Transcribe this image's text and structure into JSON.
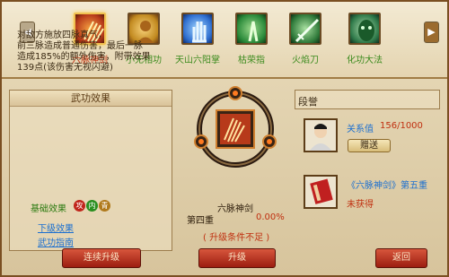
{
  "skills": [
    {
      "label": "六脉神剑",
      "selected": true,
      "icon": "sword-claw-icon",
      "color": "#b73a1a"
    },
    {
      "label": "小无相功",
      "selected": false,
      "icon": "buddha-icon",
      "color": "#c28a20"
    },
    {
      "label": "天山六阳掌",
      "selected": false,
      "icon": "palm-icon",
      "color": "#2f6fd0"
    },
    {
      "label": "枯荣指",
      "selected": false,
      "icon": "finger-icon",
      "color": "#2a8a3a"
    },
    {
      "label": "火焰刀",
      "selected": false,
      "icon": "blade-icon",
      "color": "#2f7a3a"
    },
    {
      "label": "化功大法",
      "selected": false,
      "icon": "mask-icon",
      "color": "#2f7a4a"
    }
  ],
  "left_panel": {
    "title": "武功效果",
    "effect_text": "对敌方施放四脉真气，\n前三脉造成普通伤害，最后一脉\n造成185%的额外伤害，附带效果\n139点(该伤害无视闪避)",
    "base_effect_label": "基础效果",
    "orbs": [
      "攻",
      "内",
      "青"
    ],
    "next_effect_link": "下级效果",
    "guide_link": "武功指南"
  },
  "center": {
    "skill_name": "六脉神剑",
    "level": "第四重",
    "progress": "0.00%",
    "condition": "( 升级条件不足 )"
  },
  "right_panel": {
    "title": "段誉",
    "relation_label": "关系值",
    "relation_value": "156/1000",
    "gift_button": "赠送",
    "book_label": "《六脉神剑》第五重",
    "book_status": "未获得"
  },
  "buttons": {
    "continue": "连续升级",
    "upgrade": "升级",
    "back": "返回"
  },
  "colors": {
    "accent": "#c03010",
    "link": "#1b6fd0",
    "green_text": "#3a8a1c"
  }
}
